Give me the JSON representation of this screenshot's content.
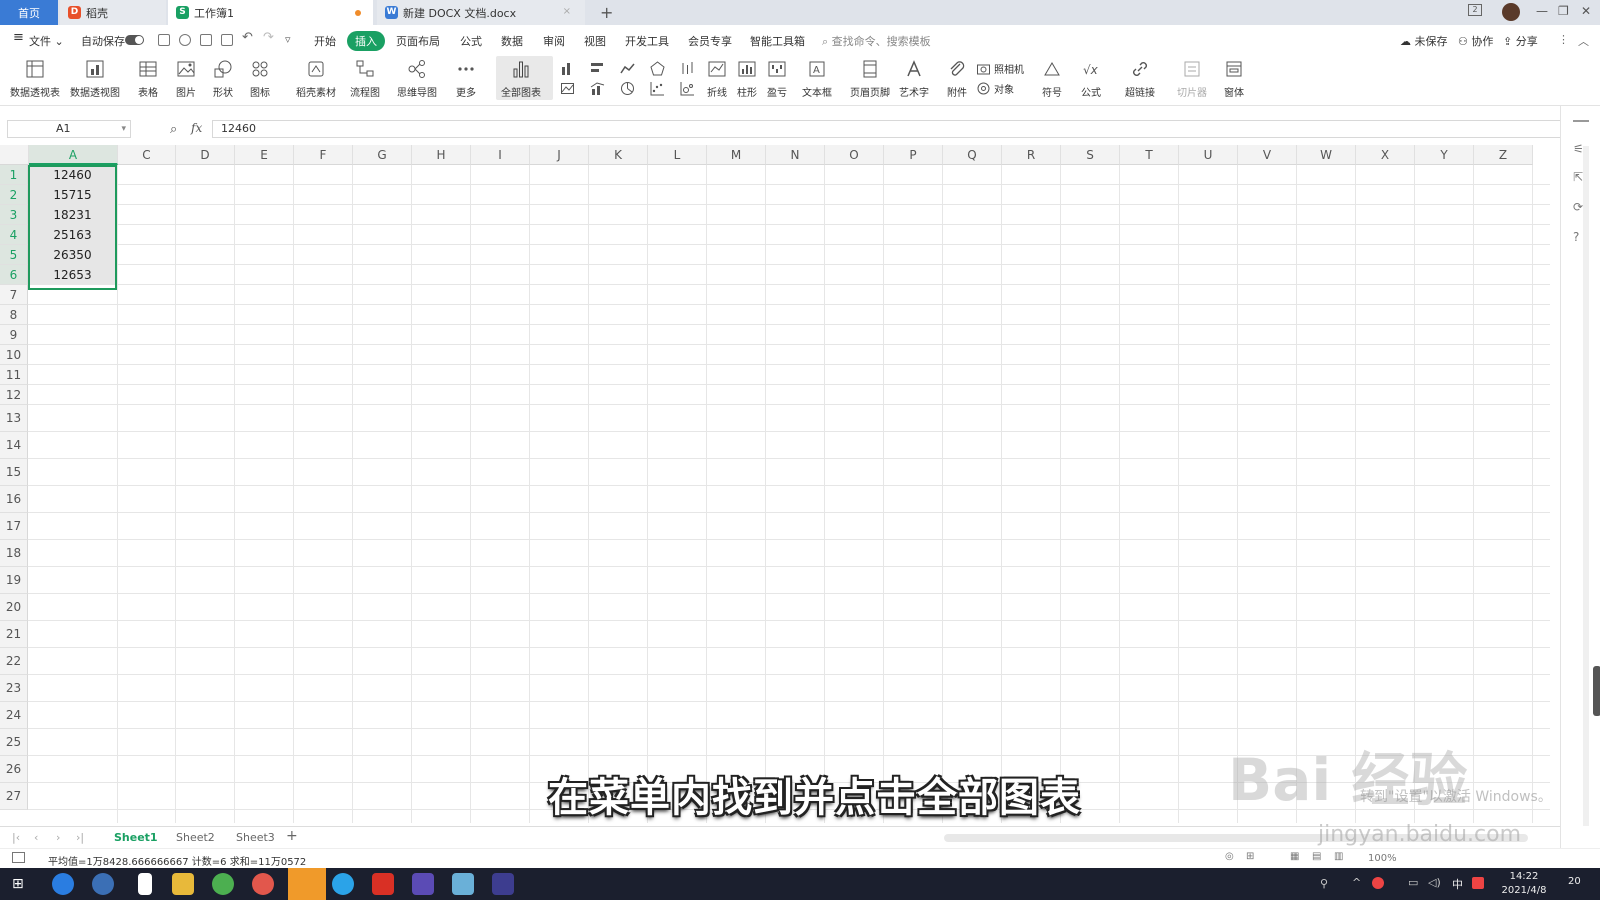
{
  "tabs": {
    "home": "首页",
    "daoke": "稻壳",
    "workbook": "工作簿1",
    "doc": "新建 DOCX 文档.docx",
    "add": "+"
  },
  "menu": {
    "file": "文件",
    "autosave": "自动保存",
    "items": [
      "开始",
      "插入",
      "页面布局",
      "公式",
      "数据",
      "审阅",
      "视图",
      "开发工具",
      "会员专享",
      "智能工具箱"
    ],
    "active_index": 1,
    "search_placeholder": "查找命令、搜索模板",
    "unsaved": "未保存",
    "collab": "协作",
    "share": "分享"
  },
  "ribbon": {
    "pivot_table": "数据透视表",
    "pivot_chart": "数据透视图",
    "table": "表格",
    "picture": "图片",
    "shape": "形状",
    "icon": "图标",
    "daoke_material": "稻壳素材",
    "flowchart": "流程图",
    "mindmap": "思维导图",
    "more": "更多",
    "all_charts": "全部图表",
    "line": "折线",
    "column": "柱形",
    "winloss": "盈亏",
    "textbox": "文本框",
    "header_footer": "页眉页脚",
    "wordart": "艺术字",
    "attachment": "附件",
    "camera": "照相机",
    "object": "对象",
    "symbol": "符号",
    "formula": "公式",
    "hyperlink": "超链接",
    "slicer": "切片器",
    "window": "窗体"
  },
  "formula_bar": {
    "name_box": "A1",
    "fx": "fx",
    "content": "12460"
  },
  "columns": [
    "A",
    "C",
    "D",
    "E",
    "F",
    "G",
    "H",
    "I",
    "J",
    "K",
    "L",
    "M",
    "N",
    "O",
    "P",
    "Q",
    "R",
    "S",
    "T",
    "U",
    "V",
    "W",
    "X",
    "Y",
    "Z"
  ],
  "rows": [
    "1",
    "2",
    "3",
    "4",
    "5",
    "6",
    "7",
    "8",
    "9",
    "10",
    "11",
    "12",
    "13",
    "14",
    "15",
    "16",
    "17",
    "18",
    "19",
    "20",
    "21",
    "22",
    "23",
    "24",
    "25",
    "26",
    "27"
  ],
  "cells_A": [
    "12460",
    "15715",
    "18231",
    "25163",
    "26350",
    "12653"
  ],
  "sheets": [
    "Sheet1",
    "Sheet2",
    "Sheet3"
  ],
  "active_sheet": "Sheet1",
  "status": {
    "text": "平均值=1万8428.666666667  计数=6  求和=11万0572",
    "zoom": "100%"
  },
  "taskbar": {
    "time": "14:22",
    "date": "2021/4/8",
    "ime": "中",
    "notif": "20"
  },
  "overlay": {
    "subtitle": "在菜单内找到并点击全部图表",
    "watermark": "Bai 经验",
    "watermark_url": "jingyan.baidu.com",
    "activate": "转到\"设置\"以激活 Windows。"
  },
  "colors": {
    "accent_green": "#1aa063",
    "selection_border": "#1e9a5c",
    "home_tab": "#3a7bd5",
    "taskbar": "#1b1f2e"
  }
}
